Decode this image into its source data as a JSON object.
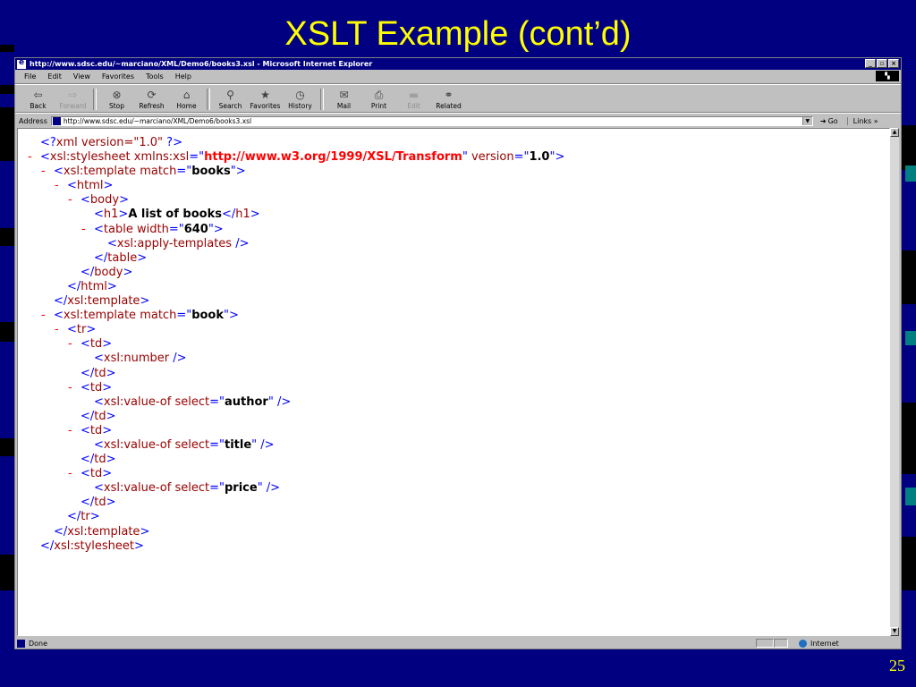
{
  "slide": {
    "title": "XSLT Example (cont’d)",
    "number": "25"
  },
  "browser": {
    "window_title": "http://www.sdsc.edu/~marciano/XML/Demo6/books3.xsl - Microsoft Internet Explorer",
    "window_buttons": [
      "_",
      "▫",
      "×"
    ],
    "menu": [
      "File",
      "Edit",
      "View",
      "Favorites",
      "Tools",
      "Help"
    ],
    "toolbar": [
      {
        "label": "Back",
        "icon": "back-arrow-icon",
        "glyph": "⇦",
        "enabled": true
      },
      {
        "label": "Forward",
        "icon": "forward-arrow-icon",
        "glyph": "⇨",
        "enabled": false
      },
      {
        "label": "Stop",
        "icon": "stop-icon",
        "glyph": "⊗",
        "enabled": true
      },
      {
        "label": "Refresh",
        "icon": "refresh-icon",
        "glyph": "⟳",
        "enabled": true
      },
      {
        "label": "Home",
        "icon": "home-icon",
        "glyph": "⌂",
        "enabled": true
      },
      {
        "label": "Search",
        "icon": "search-icon",
        "glyph": "⚲",
        "enabled": true
      },
      {
        "label": "Favorites",
        "icon": "favorites-icon",
        "glyph": "★",
        "enabled": true
      },
      {
        "label": "History",
        "icon": "history-icon",
        "glyph": "◷",
        "enabled": true
      },
      {
        "label": "Mail",
        "icon": "mail-icon",
        "glyph": "✉",
        "enabled": true
      },
      {
        "label": "Print",
        "icon": "print-icon",
        "glyph": "⎙",
        "enabled": true
      },
      {
        "label": "Edit",
        "icon": "edit-icon",
        "glyph": "▬",
        "enabled": false
      },
      {
        "label": "Related",
        "icon": "related-icon",
        "glyph": "⚭",
        "enabled": true
      }
    ],
    "address_label": "Address",
    "address_value": "http://www.sdsc.edu/~marciano/XML/Demo6/books3.xsl",
    "go_label": "Go",
    "links_label": "Links »",
    "status_text": "Done",
    "zone_text": "Internet"
  },
  "xml_lines": [
    {
      "indent": 1,
      "toggle": "",
      "parts": [
        {
          "c": "b",
          "t": "<?"
        },
        {
          "c": "t",
          "t": "xml version=\"1.0\""
        },
        {
          "c": "b",
          "t": " ?>"
        }
      ]
    },
    {
      "indent": 1,
      "toggle": "-",
      "parts": [
        {
          "c": "b",
          "t": "<"
        },
        {
          "c": "t",
          "t": "xsl:stylesheet"
        },
        {
          "c": "an",
          "t": " xmlns:xsl"
        },
        {
          "c": "b",
          "t": "=\""
        },
        {
          "c": "vns",
          "t": "http://www.w3.org/1999/XSL/Transform"
        },
        {
          "c": "b",
          "t": "\""
        },
        {
          "c": "an",
          "t": " version"
        },
        {
          "c": "b",
          "t": "=\""
        },
        {
          "c": "v",
          "t": "1.0"
        },
        {
          "c": "b",
          "t": "\">"
        }
      ]
    },
    {
      "indent": 2,
      "toggle": "-",
      "parts": [
        {
          "c": "b",
          "t": "<"
        },
        {
          "c": "t",
          "t": "xsl:template"
        },
        {
          "c": "an",
          "t": " match"
        },
        {
          "c": "b",
          "t": "=\""
        },
        {
          "c": "v",
          "t": "books"
        },
        {
          "c": "b",
          "t": "\">"
        }
      ]
    },
    {
      "indent": 3,
      "toggle": "-",
      "parts": [
        {
          "c": "b",
          "t": "<"
        },
        {
          "c": "t",
          "t": "html"
        },
        {
          "c": "b",
          "t": ">"
        }
      ]
    },
    {
      "indent": 4,
      "toggle": "-",
      "parts": [
        {
          "c": "b",
          "t": "<"
        },
        {
          "c": "t",
          "t": "body"
        },
        {
          "c": "b",
          "t": ">"
        }
      ]
    },
    {
      "indent": 5,
      "toggle": "",
      "parts": [
        {
          "c": "b",
          "t": "<"
        },
        {
          "c": "t",
          "t": "h1"
        },
        {
          "c": "b",
          "t": ">"
        },
        {
          "c": "txt",
          "t": "A list of books"
        },
        {
          "c": "b",
          "t": "</"
        },
        {
          "c": "t",
          "t": "h1"
        },
        {
          "c": "b",
          "t": ">"
        }
      ]
    },
    {
      "indent": 5,
      "toggle": "-",
      "parts": [
        {
          "c": "b",
          "t": "<"
        },
        {
          "c": "t",
          "t": "table"
        },
        {
          "c": "an",
          "t": " width"
        },
        {
          "c": "b",
          "t": "=\""
        },
        {
          "c": "v",
          "t": "640"
        },
        {
          "c": "b",
          "t": "\">"
        }
      ]
    },
    {
      "indent": 6,
      "toggle": "",
      "parts": [
        {
          "c": "b",
          "t": "<"
        },
        {
          "c": "t",
          "t": "xsl:apply-templates"
        },
        {
          "c": "b",
          "t": " />"
        }
      ]
    },
    {
      "indent": 5,
      "toggle": "",
      "parts": [
        {
          "c": "b",
          "t": "</"
        },
        {
          "c": "t",
          "t": "table"
        },
        {
          "c": "b",
          "t": ">"
        }
      ]
    },
    {
      "indent": 4,
      "toggle": "",
      "parts": [
        {
          "c": "b",
          "t": "</"
        },
        {
          "c": "t",
          "t": "body"
        },
        {
          "c": "b",
          "t": ">"
        }
      ]
    },
    {
      "indent": 3,
      "toggle": "",
      "parts": [
        {
          "c": "b",
          "t": "</"
        },
        {
          "c": "t",
          "t": "html"
        },
        {
          "c": "b",
          "t": ">"
        }
      ]
    },
    {
      "indent": 2,
      "toggle": "",
      "parts": [
        {
          "c": "b",
          "t": "</"
        },
        {
          "c": "t",
          "t": "xsl:template"
        },
        {
          "c": "b",
          "t": ">"
        }
      ]
    },
    {
      "indent": 2,
      "toggle": "-",
      "parts": [
        {
          "c": "b",
          "t": "<"
        },
        {
          "c": "t",
          "t": "xsl:template"
        },
        {
          "c": "an",
          "t": " match"
        },
        {
          "c": "b",
          "t": "=\""
        },
        {
          "c": "v",
          "t": "book"
        },
        {
          "c": "b",
          "t": "\">"
        }
      ]
    },
    {
      "indent": 3,
      "toggle": "-",
      "parts": [
        {
          "c": "b",
          "t": "<"
        },
        {
          "c": "t",
          "t": "tr"
        },
        {
          "c": "b",
          "t": ">"
        }
      ]
    },
    {
      "indent": 4,
      "toggle": "-",
      "parts": [
        {
          "c": "b",
          "t": "<"
        },
        {
          "c": "t",
          "t": "td"
        },
        {
          "c": "b",
          "t": ">"
        }
      ]
    },
    {
      "indent": 5,
      "toggle": "",
      "parts": [
        {
          "c": "b",
          "t": "<"
        },
        {
          "c": "t",
          "t": "xsl:number"
        },
        {
          "c": "b",
          "t": " />"
        }
      ]
    },
    {
      "indent": 4,
      "toggle": "",
      "parts": [
        {
          "c": "b",
          "t": "</"
        },
        {
          "c": "t",
          "t": "td"
        },
        {
          "c": "b",
          "t": ">"
        }
      ]
    },
    {
      "indent": 4,
      "toggle": "-",
      "parts": [
        {
          "c": "b",
          "t": "<"
        },
        {
          "c": "t",
          "t": "td"
        },
        {
          "c": "b",
          "t": ">"
        }
      ]
    },
    {
      "indent": 5,
      "toggle": "",
      "parts": [
        {
          "c": "b",
          "t": "<"
        },
        {
          "c": "t",
          "t": "xsl:value-of"
        },
        {
          "c": "an",
          "t": " select"
        },
        {
          "c": "b",
          "t": "=\""
        },
        {
          "c": "v",
          "t": "author"
        },
        {
          "c": "b",
          "t": "\" />"
        }
      ]
    },
    {
      "indent": 4,
      "toggle": "",
      "parts": [
        {
          "c": "b",
          "t": "</"
        },
        {
          "c": "t",
          "t": "td"
        },
        {
          "c": "b",
          "t": ">"
        }
      ]
    },
    {
      "indent": 4,
      "toggle": "-",
      "parts": [
        {
          "c": "b",
          "t": "<"
        },
        {
          "c": "t",
          "t": "td"
        },
        {
          "c": "b",
          "t": ">"
        }
      ]
    },
    {
      "indent": 5,
      "toggle": "",
      "parts": [
        {
          "c": "b",
          "t": "<"
        },
        {
          "c": "t",
          "t": "xsl:value-of"
        },
        {
          "c": "an",
          "t": " select"
        },
        {
          "c": "b",
          "t": "=\""
        },
        {
          "c": "v",
          "t": "title"
        },
        {
          "c": "b",
          "t": "\" />"
        }
      ]
    },
    {
      "indent": 4,
      "toggle": "",
      "parts": [
        {
          "c": "b",
          "t": "</"
        },
        {
          "c": "t",
          "t": "td"
        },
        {
          "c": "b",
          "t": ">"
        }
      ]
    },
    {
      "indent": 4,
      "toggle": "-",
      "parts": [
        {
          "c": "b",
          "t": "<"
        },
        {
          "c": "t",
          "t": "td"
        },
        {
          "c": "b",
          "t": ">"
        }
      ]
    },
    {
      "indent": 5,
      "toggle": "",
      "parts": [
        {
          "c": "b",
          "t": "<"
        },
        {
          "c": "t",
          "t": "xsl:value-of"
        },
        {
          "c": "an",
          "t": " select"
        },
        {
          "c": "b",
          "t": "=\""
        },
        {
          "c": "v",
          "t": "price"
        },
        {
          "c": "b",
          "t": "\" />"
        }
      ]
    },
    {
      "indent": 4,
      "toggle": "",
      "parts": [
        {
          "c": "b",
          "t": "</"
        },
        {
          "c": "t",
          "t": "td"
        },
        {
          "c": "b",
          "t": ">"
        }
      ]
    },
    {
      "indent": 3,
      "toggle": "",
      "parts": [
        {
          "c": "b",
          "t": "</"
        },
        {
          "c": "t",
          "t": "tr"
        },
        {
          "c": "b",
          "t": ">"
        }
      ]
    },
    {
      "indent": 2,
      "toggle": "",
      "parts": [
        {
          "c": "b",
          "t": "</"
        },
        {
          "c": "t",
          "t": "xsl:template"
        },
        {
          "c": "b",
          "t": ">"
        }
      ]
    },
    {
      "indent": 1,
      "toggle": "",
      "parts": [
        {
          "c": "b",
          "t": "</"
        },
        {
          "c": "t",
          "t": "xsl:stylesheet"
        },
        {
          "c": "b",
          "t": ">"
        }
      ]
    }
  ]
}
